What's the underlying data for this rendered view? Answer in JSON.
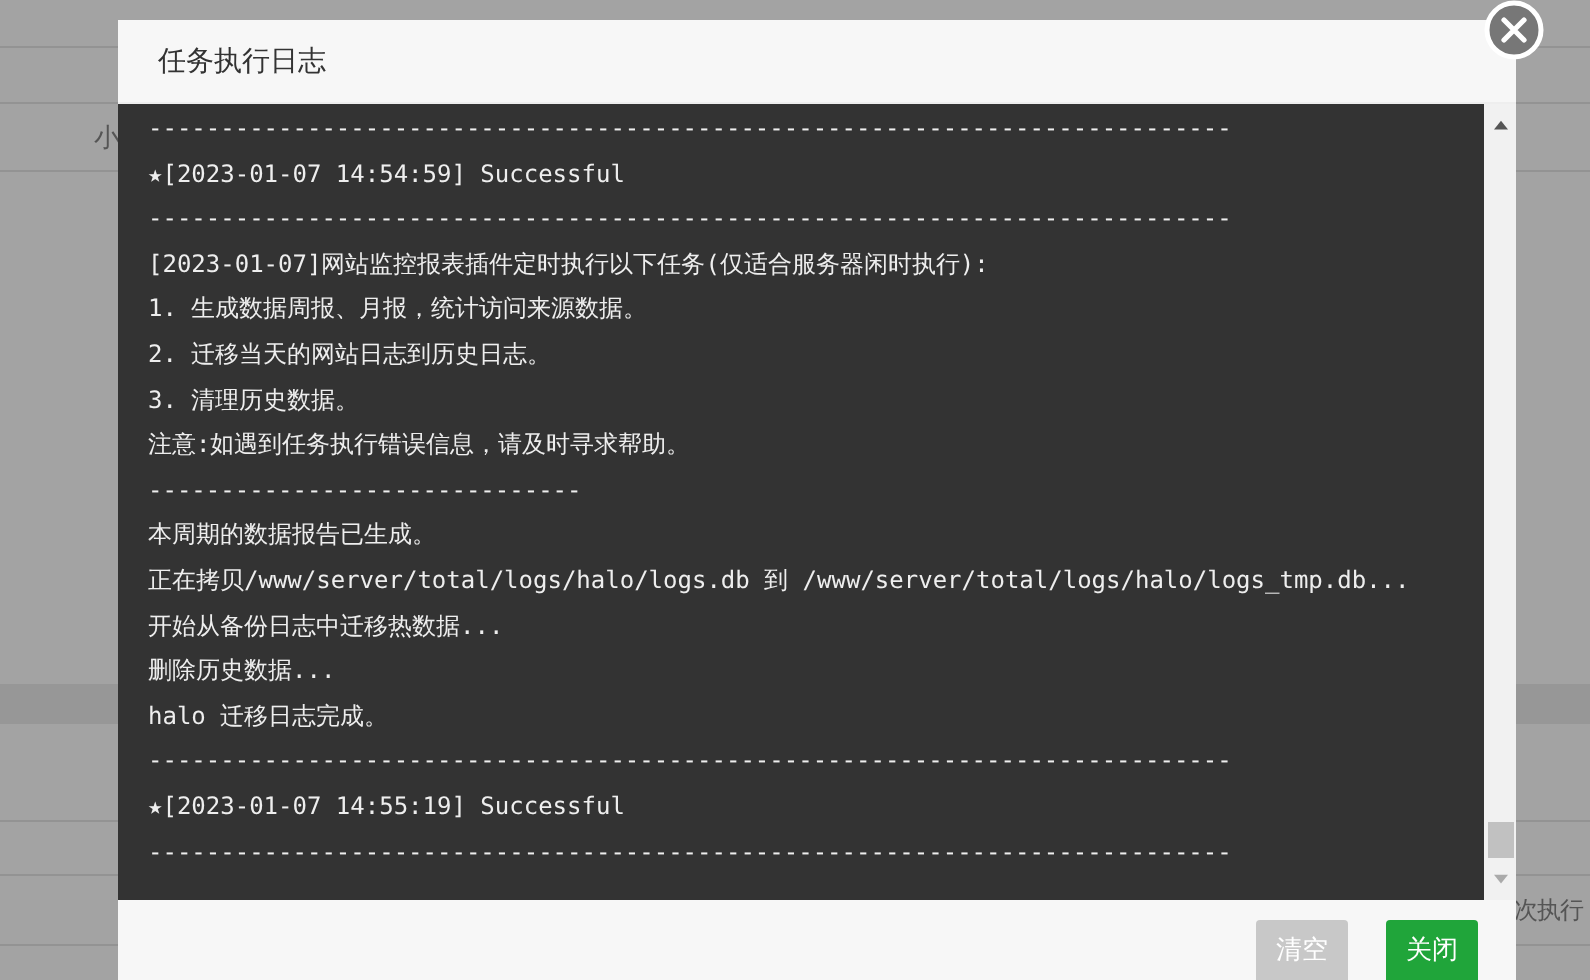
{
  "background": {
    "cells": [
      "小",
      "次执行"
    ]
  },
  "dialog": {
    "title": "任务执行日志",
    "log_lines": [
      "---------------------------------------------------------------------------",
      "★[2023-01-07 14:54:59] Successful",
      "---------------------------------------------------------------------------",
      "[2023-01-07]网站监控报表插件定时执行以下任务(仅适合服务器闲时执行):",
      "1. 生成数据周报、月报，统计访问来源数据。",
      "2. 迁移当天的网站日志到历史日志。",
      "3. 清理历史数据。",
      "注意:如遇到任务执行错误信息，请及时寻求帮助。",
      "------------------------------",
      "本周期的数据报告已生成。",
      "正在拷贝/www/server/total/logs/halo/logs.db 到 /www/server/total/logs/halo/logs_tmp.db...",
      "开始从备份日志中迁移热数据...",
      "删除历史数据...",
      "halo 迁移日志完成。",
      "---------------------------------------------------------------------------",
      "★[2023-01-07 14:55:19] Successful",
      "---------------------------------------------------------------------------"
    ],
    "buttons": [
      {
        "label": "清空",
        "kind": "secondary"
      },
      {
        "label": "关闭",
        "kind": "primary"
      }
    ]
  }
}
